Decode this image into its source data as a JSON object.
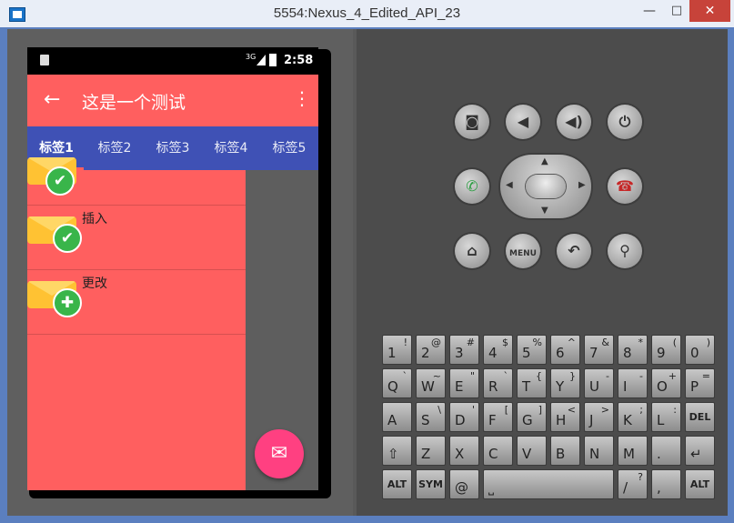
{
  "window": {
    "title": "5554:Nexus_4_Edited_API_23",
    "minimize_glyph": "—",
    "maximize_glyph": "□",
    "close_glyph": "✕"
  },
  "phone": {
    "status_bar": {
      "network": "3G",
      "time": "2:58"
    },
    "toolbar": {
      "title": "这是一个测试",
      "back_glyph": "←",
      "more_glyph": "⋮"
    },
    "tabs": [
      "标签1",
      "标签2",
      "标签3",
      "标签4",
      "标签5"
    ],
    "active_tab": "标签1",
    "list_items": [
      {
        "label": "",
        "badge": "✔"
      },
      {
        "label": "插入",
        "badge": "✔"
      },
      {
        "label": "更改",
        "badge": "✚"
      }
    ],
    "fab_glyph": "✉"
  },
  "hardware_buttons": {
    "row1": [
      "camera-icon",
      "volume-down-icon",
      "volume-up-icon",
      "power-icon"
    ],
    "row1_glyphs": [
      "◙",
      "◀",
      "◀)",
      "⏻"
    ],
    "row2": {
      "call_glyph": "✆",
      "endcall_glyph": "☎"
    },
    "row3_glyphs": [
      "⌂",
      "MENU",
      "↶",
      "⚲"
    ]
  },
  "keyboard": {
    "rows": [
      [
        [
          "1",
          "!"
        ],
        [
          "2",
          "@"
        ],
        [
          "3",
          "#"
        ],
        [
          "4",
          "$"
        ],
        [
          "5",
          "%"
        ],
        [
          "6",
          "^"
        ],
        [
          "7",
          "&"
        ],
        [
          "8",
          "*"
        ],
        [
          "9",
          "("
        ],
        [
          "0",
          ")"
        ]
      ],
      [
        [
          "Q",
          "`"
        ],
        [
          "W",
          "~"
        ],
        [
          "E",
          "\""
        ],
        [
          "R",
          "`"
        ],
        [
          "T",
          "{"
        ],
        [
          "Y",
          "}"
        ],
        [
          "U",
          "-"
        ],
        [
          "I",
          "-"
        ],
        [
          "O",
          "+"
        ],
        [
          "P",
          "="
        ]
      ],
      [
        [
          "A",
          ""
        ],
        [
          "S",
          "\\"
        ],
        [
          "D",
          "'"
        ],
        [
          "F",
          "["
        ],
        [
          "G",
          "]"
        ],
        [
          "H",
          "<"
        ],
        [
          "J",
          ">"
        ],
        [
          "K",
          ";"
        ],
        [
          "L",
          ":"
        ],
        [
          "DEL",
          ""
        ]
      ],
      [
        [
          "⇧",
          ""
        ],
        [
          "Z",
          ""
        ],
        [
          "X",
          ""
        ],
        [
          "C",
          ""
        ],
        [
          "V",
          ""
        ],
        [
          "B",
          ""
        ],
        [
          "N",
          ""
        ],
        [
          "M",
          ""
        ],
        [
          ".",
          ""
        ],
        [
          "↵",
          ""
        ]
      ],
      [
        [
          "ALT",
          ""
        ],
        [
          "SYM",
          ""
        ],
        [
          "@",
          ""
        ],
        [
          "⎵",
          ""
        ],
        [
          "/",
          "?"
        ],
        [
          ",",
          ""
        ],
        [
          "ALT",
          ""
        ]
      ]
    ]
  },
  "colors": {
    "toolbar": "#ff5f5f",
    "tabs": "#3f51b5",
    "fab": "#ff4081",
    "badge": "#39b54a",
    "close_button": "#c7433a"
  }
}
